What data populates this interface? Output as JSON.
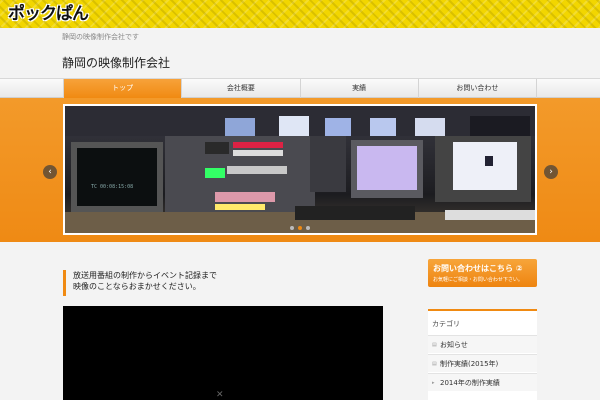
{
  "logo": {
    "text": "ポックぱん"
  },
  "tagline": "静岡の映像制作会社です",
  "site_title": "静岡の映像制作会社",
  "nav": [
    {
      "label": "トップ",
      "active": true
    },
    {
      "label": "会社概要",
      "active": false
    },
    {
      "label": "実績",
      "active": false
    },
    {
      "label": "お問い合わせ",
      "active": false
    }
  ],
  "slider": {
    "prev_icon": "‹",
    "next_icon": "›"
  },
  "content": {
    "heading_line1": "放送用番組の制作からイベント記録まで",
    "heading_line2": "映像のことならおまかせください。",
    "video_mark": "✕"
  },
  "contact": {
    "main": "お問い合わせはこちら ②",
    "sub": "お気軽にご相談・お問い合わせ下さい。"
  },
  "sidebar": {
    "title": "カテゴリ",
    "items": [
      {
        "label": "お知らせ",
        "bullet": "▤"
      },
      {
        "label": "制作実績(2015年)",
        "bullet": "▤"
      },
      {
        "label": "2014年の制作実績",
        "bullet": "▸"
      }
    ]
  },
  "colors": {
    "accent": "#f08a12",
    "logo_bg": "#f2d600"
  }
}
